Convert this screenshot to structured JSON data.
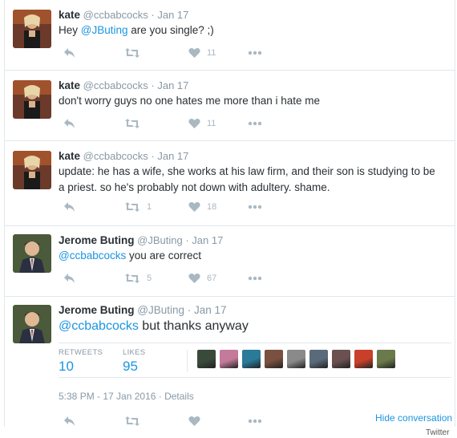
{
  "tweets": [
    {
      "name": "kate",
      "handle": "@ccbabcocks",
      "date": "· Jan 17",
      "text_before": "Hey ",
      "mention": "@JButing",
      "text_after": " are you single? ;)",
      "retweets": "",
      "likes": "11"
    },
    {
      "name": "kate",
      "handle": "@ccbabcocks",
      "date": "· Jan 17",
      "text": "don't worry guys no one hates me more than i hate me",
      "retweets": "",
      "likes": "11"
    },
    {
      "name": "kate",
      "handle": "@ccbabcocks",
      "date": "· Jan 17",
      "text_line1": "update: he has a wife, she works at his law firm, and their son is studying to be",
      "text_line2": "a priest. so he's probably not down with adultery. shame.",
      "retweets": "1",
      "likes": "18"
    },
    {
      "name": "Jerome Buting",
      "handle": "@JButing",
      "date": "· Jan 17",
      "mention": "@ccbabcocks",
      "text_after": " you are correct",
      "retweets": "5",
      "likes": "67"
    }
  ],
  "focused": {
    "name": "Jerome Buting",
    "handle": "@JButing",
    "date": "· Jan 17",
    "mention": "@ccbabcocks",
    "text_after": " but thanks anyway",
    "retweets_label": "RETWEETS",
    "retweets": "10",
    "likes_label": "LIKES",
    "likes": "95",
    "timestamp": "5:38 PM - 17 Jan 2016",
    "details": " · Details",
    "hide_conversation": "Hide conversation"
  },
  "liker_faces": [
    "#3a4a3a",
    "#c47a9a",
    "#2a7a9a",
    "#7a5040",
    "#8a8a8a",
    "#5a6a7a",
    "#6a5050",
    "#c8402a",
    "#6a7a4a"
  ],
  "credit": "Twitter",
  "colors": {
    "link": "#1b95e0",
    "muted": "#8899a6",
    "icon": "#aab8c2",
    "border": "#e1e8ed"
  },
  "icons": [
    "reply-icon",
    "retweet-icon",
    "heart-icon",
    "more-icon"
  ]
}
